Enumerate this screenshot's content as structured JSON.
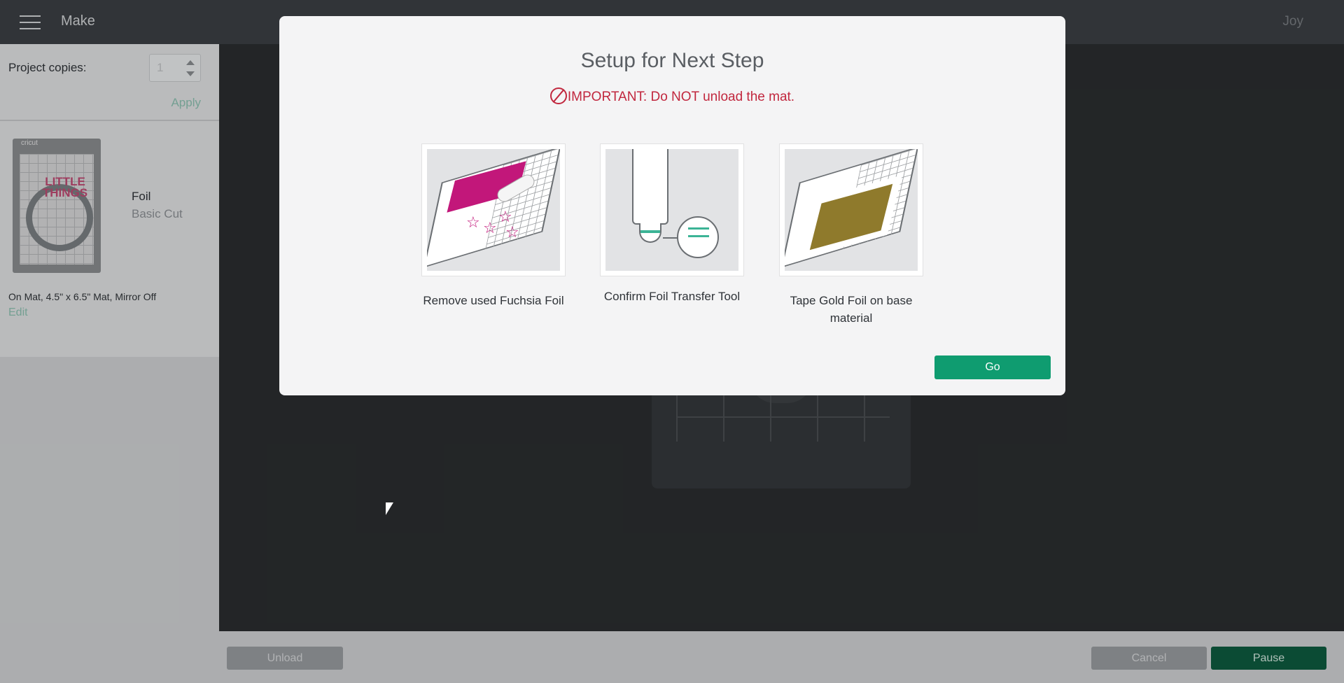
{
  "header": {
    "title": "Make",
    "user": "Joy"
  },
  "sidebar": {
    "project_copies_label": "Project copies:",
    "project_copies_value": "1",
    "apply_label": "Apply",
    "mat": {
      "brand": "cricut",
      "design_text": "LITTLE THINGS",
      "name": "Foil",
      "operation": "Basic Cut",
      "info": "On Mat, 4.5\" x 6.5\" Mat, Mirror Off",
      "edit_label": "Edit"
    }
  },
  "footer": {
    "unload_label": "Unload",
    "cancel_label": "Cancel",
    "pause_label": "Pause"
  },
  "modal": {
    "title": "Setup for Next Step",
    "warning": "IMPORTANT: Do NOT unload the mat.",
    "steps": [
      {
        "label": "Remove used Fuchsia Foil",
        "icon": "remove-foil-illustration"
      },
      {
        "label": "Confirm Foil Transfer Tool",
        "icon": "foil-tool-illustration"
      },
      {
        "label": "Tape Gold Foil on base material",
        "icon": "tape-gold-foil-illustration"
      }
    ],
    "go_label": "Go"
  },
  "colors": {
    "accent": "#0f9c70",
    "warning": "#c1273e",
    "fuchsia_foil": "#c2177a",
    "gold_foil": "#8f7a2c"
  }
}
